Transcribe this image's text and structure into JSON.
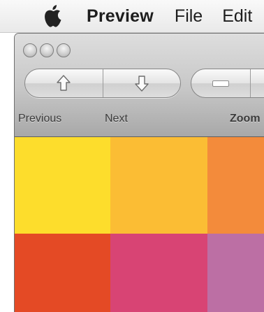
{
  "menubar": {
    "app_name": "Preview",
    "items": [
      "File",
      "Edit"
    ]
  },
  "toolbar": {
    "previous_label": "Previous",
    "next_label": "Next",
    "zoom_label": "Zoom"
  },
  "swatches": [
    {
      "color": "#fddd2c"
    },
    {
      "color": "#fbbd34"
    },
    {
      "color": "#f38b3b"
    },
    {
      "color": "#e44a25"
    },
    {
      "color": "#d84474"
    },
    {
      "color": "#bc6fa4"
    }
  ]
}
